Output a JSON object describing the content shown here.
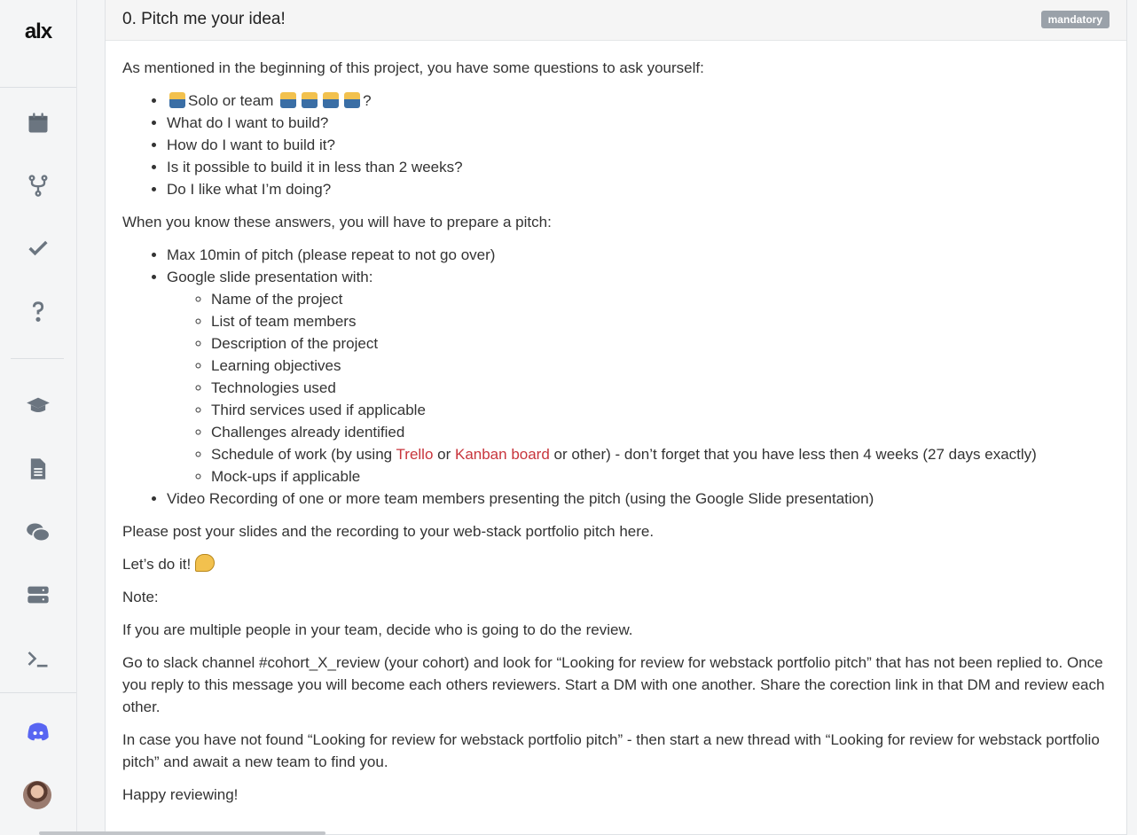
{
  "brand": {
    "logo_text": "alx"
  },
  "sidebar": {
    "items": [
      {
        "name": "calendar-icon"
      },
      {
        "name": "projects-branch-icon"
      },
      {
        "name": "checkmark-icon"
      },
      {
        "name": "help-icon"
      },
      {
        "name": "graduation-cap-icon"
      },
      {
        "name": "document-icon"
      },
      {
        "name": "chat-icon"
      },
      {
        "name": "servers-icon"
      },
      {
        "name": "terminal-icon"
      },
      {
        "name": "discord-icon"
      }
    ]
  },
  "task": {
    "title": "0. Pitch me your idea!",
    "badge": "mandatory",
    "intro": "As mentioned in the beginning of this project, you have some questions to ask yourself:",
    "questions": {
      "q1_text": "Solo or team",
      "q1_suffix": "?",
      "q2": "What do I want to build?",
      "q3": "How do I want to build it?",
      "q4": "Is it possible to build it in less than 2 weeks?",
      "q5": "Do I like what I’m doing?"
    },
    "pitch_intro": "When you know these answers, you will have to prepare a pitch:",
    "pitch": {
      "item1": "Max 10min of pitch (please repeat to not go over)",
      "item2": "Google slide presentation with:",
      "slides": {
        "s1": "Name of the project",
        "s2": "List of team members",
        "s3": "Description of the project",
        "s4": "Learning objectives",
        "s5": "Technologies used",
        "s6": "Third services used if applicable",
        "s7": "Challenges already identified",
        "s8_prefix": "Schedule of work (by using ",
        "s8_link1": "Trello",
        "s8_mid": " or ",
        "s8_link2": "Kanban board",
        "s8_suffix": " or other) - don’t forget that you have less then 4 weeks (27 days exactly)",
        "s9": "Mock-ups if applicable"
      },
      "item3": "Video Recording of one or more team members presenting the pitch (using the Google Slide presentation)"
    },
    "post": "Please post your slides and the recording to your web-stack portfolio pitch here.",
    "lets_do_it": "Let’s do it!",
    "note_label": "Note:",
    "note1": "If you are multiple people in your team, decide who is going to do the review.",
    "note2": "Go to slack channel #cohort_X_review (your cohort) and look for “Looking for review for webstack portfolio pitch” that has not been replied to. Once you reply to this message you will become each others reviewers. Start a DM with one another. Share the corection link in that DM and review each other.",
    "note3": "In case you have not found “Looking for review for webstack portfolio pitch” - then start a new thread with “Looking for review for webstack portfolio pitch” and await a new team to find you.",
    "closing": "Happy reviewing!"
  },
  "colors": {
    "link": "#c8353c",
    "icon": "#6b7580",
    "discord": "#5865f2",
    "badge": "#9aa1a9"
  }
}
